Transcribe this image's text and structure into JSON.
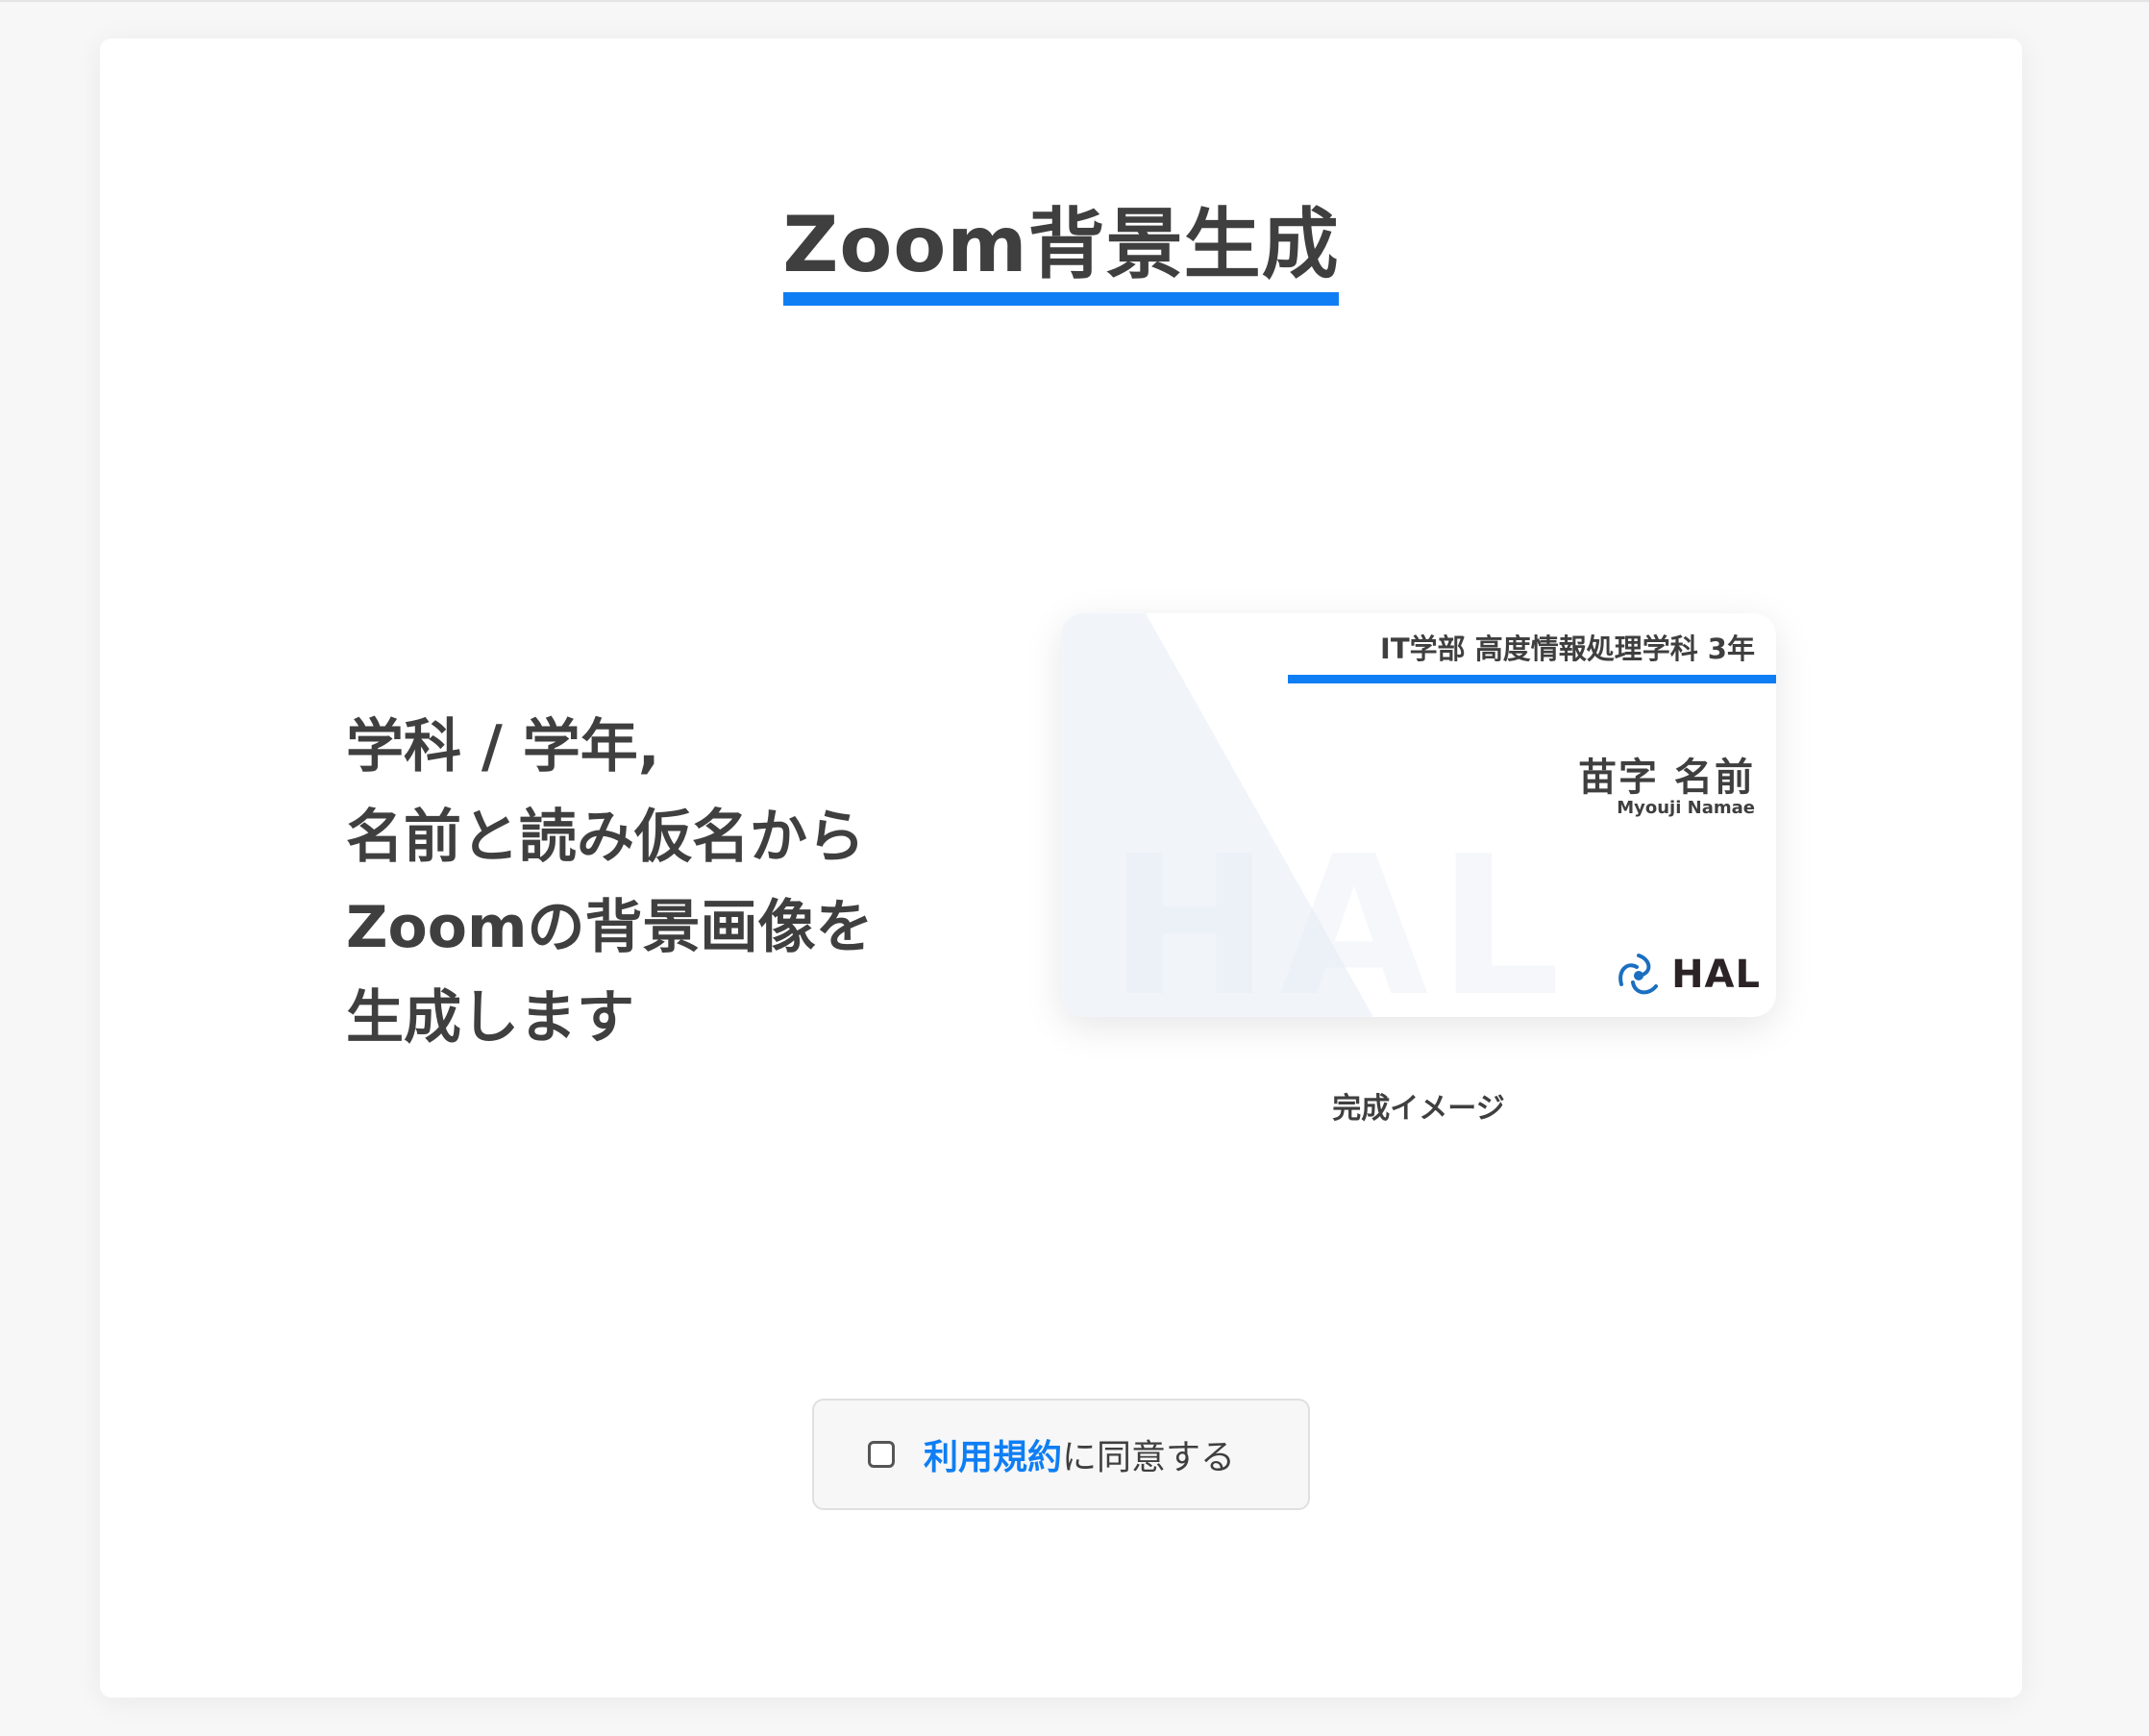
{
  "page": {
    "title": "Zoom背景生成",
    "description_lines": [
      "学科 / 学年,",
      "名前と読み仮名から",
      "Zoomの背景画像を",
      "生成します"
    ]
  },
  "preview": {
    "department": "IT学部 高度情報処理学科 3年",
    "name": "苗字 名前",
    "reading": "Myouji Namae",
    "watermark": "HAL",
    "logo_text": "HAL",
    "logo_icon": "hal-logo-icon",
    "caption": "完成イメージ"
  },
  "agreement": {
    "link_label": "利用規約",
    "suffix": "に同意する",
    "checked": false
  },
  "colors": {
    "accent": "#0f7ef4",
    "text": "#3f3f3f",
    "background": "#f7f7f7",
    "card": "#ffffff"
  }
}
